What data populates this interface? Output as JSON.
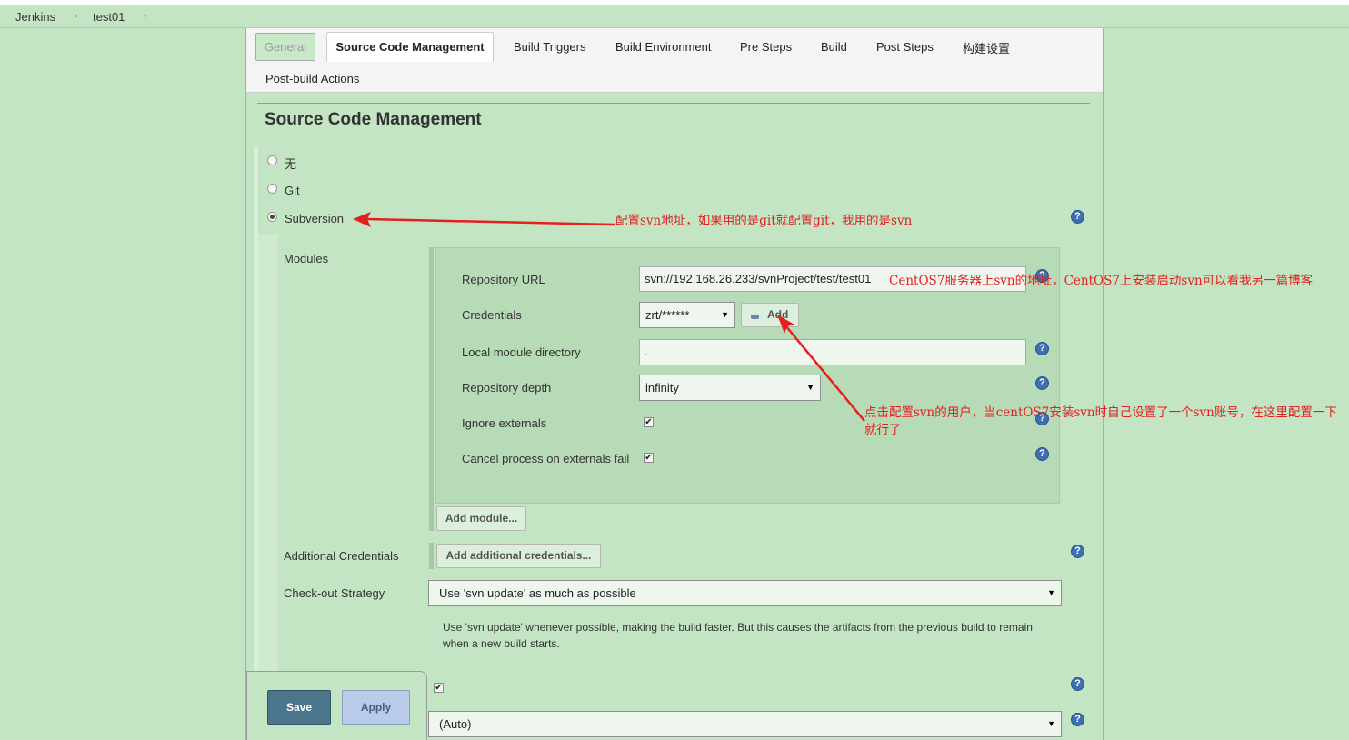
{
  "breadcrumb": {
    "items": [
      "Jenkins",
      "test01"
    ],
    "separator": "›"
  },
  "tabs": {
    "general": "General",
    "source_code_management": "Source Code Management",
    "build_triggers": "Build Triggers",
    "build_environment": "Build Environment",
    "pre_steps": "Pre Steps",
    "build": "Build",
    "post_steps": "Post Steps",
    "build_settings": "构建设置",
    "post_build_actions": "Post-build Actions"
  },
  "section": {
    "title": "Source Code Management"
  },
  "scm_options": {
    "none": "无",
    "git": "Git",
    "subversion": "Subversion",
    "selected": "Subversion"
  },
  "subversion": {
    "modules_label": "Modules",
    "repository_url": {
      "label": "Repository URL",
      "value": "svn://192.168.26.233/svnProject/test/test01"
    },
    "credentials": {
      "label": "Credentials",
      "value": "zrt/******",
      "add_button": "Add"
    },
    "local_module_directory": {
      "label": "Local module directory",
      "value": "."
    },
    "repository_depth": {
      "label": "Repository depth",
      "value": "infinity"
    },
    "ignore_externals": {
      "label": "Ignore externals",
      "checked": true
    },
    "cancel_process": {
      "label": "Cancel process on externals fail",
      "checked": true
    },
    "add_module_button": "Add module...",
    "additional_credentials": {
      "label": "Additional Credentials",
      "button": "Add additional credentials..."
    },
    "checkout_strategy": {
      "label": "Check-out Strategy",
      "value": "Use 'svn update' as much as possible",
      "description": "Use 'svn update' whenever possible, making the build faster. But this causes the artifacts from the previous build to remain when a new build starts."
    },
    "bottom_checkbox": {
      "checked": true
    },
    "browser_select": {
      "value": "(Auto)"
    }
  },
  "actions": {
    "save": "Save",
    "apply": "Apply"
  },
  "help_icon_glyph": "?",
  "check_glyph": "✔",
  "select_arrow_glyph": "▼",
  "annotations": {
    "subversion_note": "配置svn地址，如果用的是git就配置git，我用的是svn",
    "url_note": "CentOS7服务器上svn的地址，CentOS7上安装启动svn可以看我另一篇博客",
    "credentials_note": "点击配置svn的用户，当centOS7安装svn时自己设置了一个svn账号，在这里配置一下就行了"
  },
  "colors": {
    "page_background": "#c3e5c3",
    "annotation_red": "#e41f1f",
    "save_button": "#4b758b",
    "apply_button": "#b9cbe8",
    "help_icon": "#3f6fb2"
  }
}
